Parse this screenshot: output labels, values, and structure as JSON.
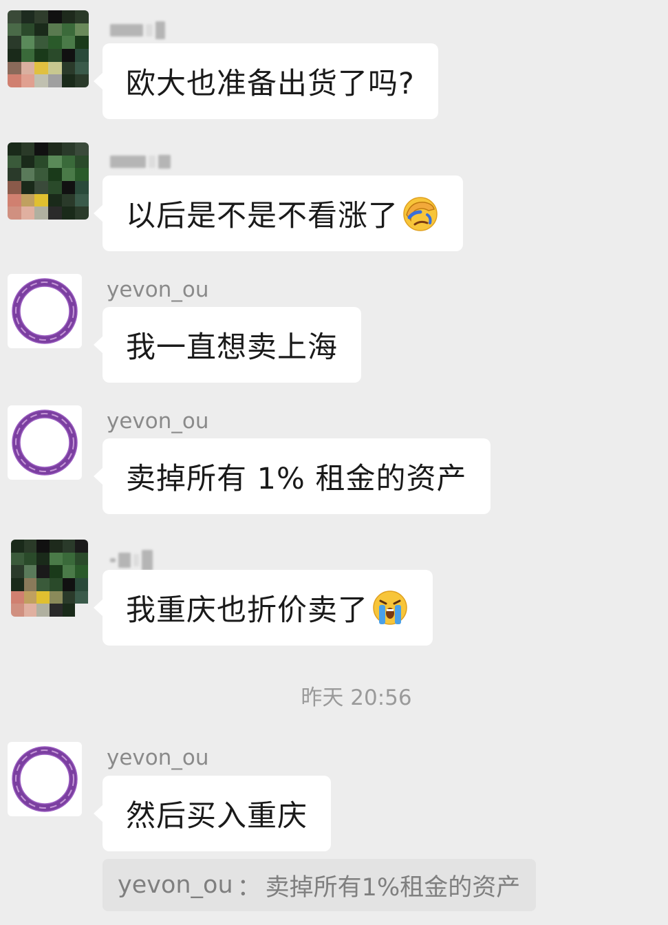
{
  "messages": [
    {
      "id": "m1",
      "sender": "",
      "sender_blurred": true,
      "avatar": "pixelated-photo",
      "text": "欧大也准备出货了吗?",
      "emoji": ""
    },
    {
      "id": "m2",
      "sender": "",
      "sender_blurred": true,
      "avatar": "pixelated-photo",
      "text": "以后是不是不看涨了",
      "emoji": "facepalm-crying-emoji"
    },
    {
      "id": "m3",
      "sender": "yevon_ou",
      "avatar": "purple-ring-logo",
      "text": "我一直想卖上海",
      "emoji": ""
    },
    {
      "id": "m4",
      "sender": "yevon_ou",
      "avatar": "purple-ring-logo",
      "text": "卖掉所有 1% 租金的资产",
      "emoji": ""
    },
    {
      "id": "m5",
      "sender": "",
      "sender_blurred": true,
      "avatar": "pixelated-photo",
      "text": "我重庆也折价卖了",
      "emoji": "loudly-crying-emoji"
    },
    {
      "id": "m6",
      "sender": "yevon_ou",
      "avatar": "purple-ring-logo",
      "text": "然后买入重庆",
      "emoji": ""
    }
  ],
  "timestamp": "昨天 20:56",
  "quote": {
    "author": "yevon_ou",
    "separator": "：",
    "text": "卖掉所有1%租金的资产"
  },
  "colors": {
    "background": "#ededed",
    "bubble": "#ffffff",
    "quote_bg": "#e3e3e3",
    "ring_purple": "#7b3fa0"
  }
}
